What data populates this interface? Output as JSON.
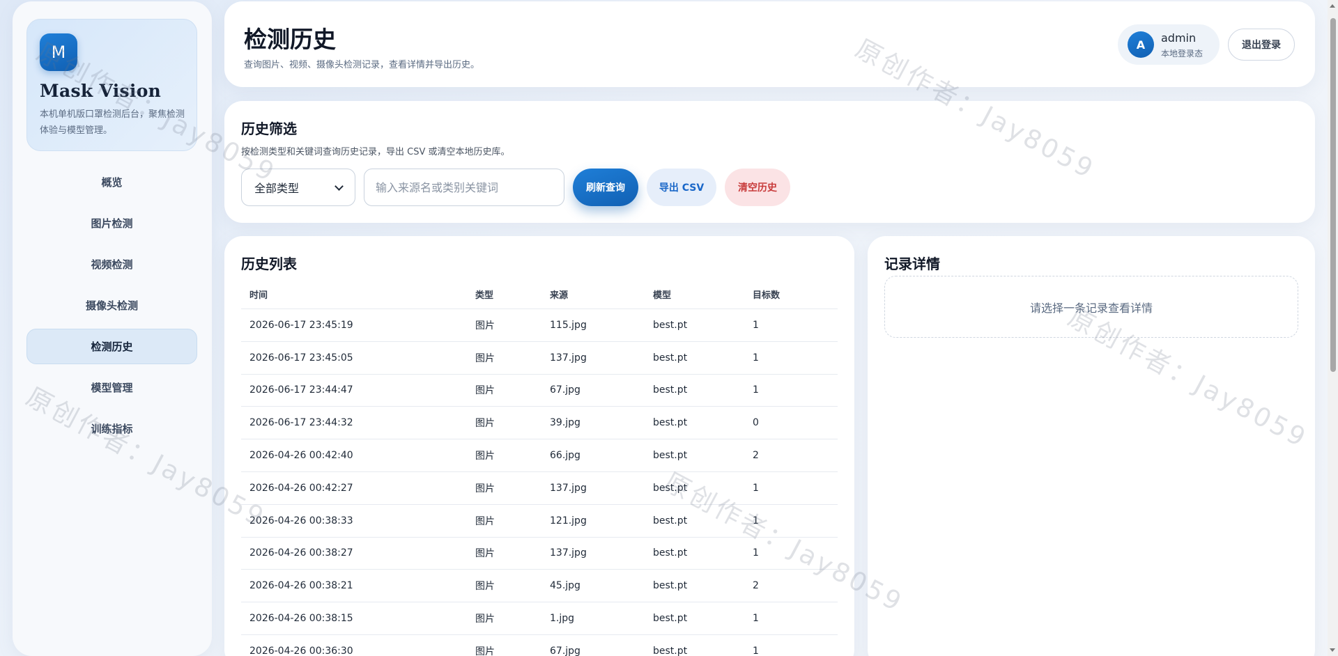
{
  "sidebar": {
    "logo_letter": "M",
    "brand_title": "Mask Vision",
    "brand_desc": "本机单机版口罩检测后台，聚焦检测体验与模型管理。",
    "items": [
      {
        "label": "概览"
      },
      {
        "label": "图片检测"
      },
      {
        "label": "视频检测"
      },
      {
        "label": "摄像头检测"
      },
      {
        "label": "检测历史",
        "active": true
      },
      {
        "label": "模型管理"
      },
      {
        "label": "训练指标"
      }
    ]
  },
  "header": {
    "title": "检测历史",
    "subtitle": "查询图片、视频、摄像头检测记录，查看详情并导出历史。",
    "user": {
      "avatar_letter": "A",
      "name": "admin",
      "status": "本地登录态"
    },
    "logout_label": "退出登录"
  },
  "filter": {
    "title": "历史筛选",
    "subtitle": "按检测类型和关键词查询历史记录，导出 CSV 或清空本地历史库。",
    "type_select_value": "全部类型",
    "keyword_placeholder": "输入来源名或类别关键词",
    "refresh_label": "刷新查询",
    "export_label": "导出 CSV",
    "clear_label": "清空历史"
  },
  "history": {
    "title": "历史列表",
    "columns": [
      "时间",
      "类型",
      "来源",
      "模型",
      "目标数"
    ],
    "rows": [
      [
        "2026-06-17 23:45:19",
        "图片",
        "115.jpg",
        "best.pt",
        "1"
      ],
      [
        "2026-06-17 23:45:05",
        "图片",
        "137.jpg",
        "best.pt",
        "1"
      ],
      [
        "2026-06-17 23:44:47",
        "图片",
        "67.jpg",
        "best.pt",
        "1"
      ],
      [
        "2026-06-17 23:44:32",
        "图片",
        "39.jpg",
        "best.pt",
        "0"
      ],
      [
        "2026-04-26 00:42:40",
        "图片",
        "66.jpg",
        "best.pt",
        "2"
      ],
      [
        "2026-04-26 00:42:27",
        "图片",
        "137.jpg",
        "best.pt",
        "1"
      ],
      [
        "2026-04-26 00:38:33",
        "图片",
        "121.jpg",
        "best.pt",
        "1"
      ],
      [
        "2026-04-26 00:38:27",
        "图片",
        "137.jpg",
        "best.pt",
        "1"
      ],
      [
        "2026-04-26 00:38:21",
        "图片",
        "45.jpg",
        "best.pt",
        "2"
      ],
      [
        "2026-04-26 00:38:15",
        "图片",
        "1.jpg",
        "best.pt",
        "1"
      ],
      [
        "2026-04-26 00:36:30",
        "图片",
        "67.jpg",
        "best.pt",
        "1"
      ]
    ]
  },
  "detail": {
    "title": "记录详情",
    "empty_text": "请选择一条记录查看详情"
  },
  "watermark": {
    "text": "原创作者：Jay8059"
  }
}
